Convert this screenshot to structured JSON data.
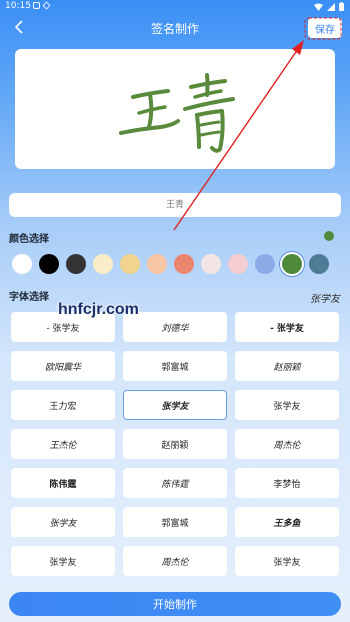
{
  "status_bar": {
    "time": "10:15"
  },
  "header": {
    "title": "签名制作",
    "save_label": "保存"
  },
  "signature_preview": {
    "text": "王青",
    "color": "#5a8a3c"
  },
  "name_input": {
    "value": "",
    "placeholder": "王青"
  },
  "color_section": {
    "label": "颜色选择",
    "current_color": "#4e8a3a",
    "swatches": [
      "#ffffff",
      "#000000",
      "#333333",
      "#fbecc9",
      "#f2d48c",
      "#f7c6a4",
      "#ec8570",
      "#f4e5e5",
      "#f3cdd2",
      "#8ea9e8",
      "#4e8a3a",
      "#4e7c96"
    ],
    "selected_index": 10
  },
  "font_section": {
    "label": "字体选择",
    "current_font": "张学友",
    "fonts": [
      "- 张学友",
      "刘德华",
      "- 张学友",
      "欧阳震华",
      "郭富城",
      "赵丽颖",
      "王力宏",
      "张学友",
      "张学友",
      "王杰伦",
      "赵丽颖",
      "周杰伦",
      "陈伟霆",
      "陈伟霆",
      "李梦怡",
      "张学友",
      "郭富城",
      "王多鱼",
      "张学友",
      "周杰伦",
      "张学友"
    ],
    "selected_index": 7
  },
  "watermark": "hnfcjr.com",
  "start_button": {
    "label": "开始制作"
  }
}
